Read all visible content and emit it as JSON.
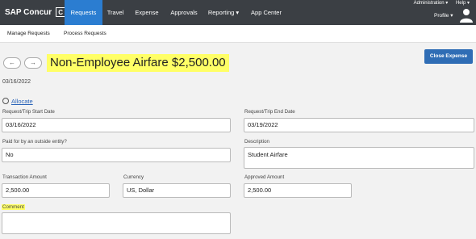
{
  "brand": {
    "name": "SAP Concur",
    "logo_letter": "C"
  },
  "nav": {
    "tabs": [
      {
        "label": "Requests"
      },
      {
        "label": "Travel"
      },
      {
        "label": "Expense"
      },
      {
        "label": "Approvals"
      },
      {
        "label": "Reporting ▾"
      },
      {
        "label": "App Center"
      }
    ],
    "administration": "Administration ▾",
    "help": "Help ▾",
    "profile": "Profile ▾"
  },
  "subnav": {
    "manage": "Manage Requests",
    "process": "Process Requests"
  },
  "header": {
    "back_icon": "←",
    "forward_icon": "→",
    "title": "Non-Employee Airfare $2,500.00",
    "date": "03/16/2022",
    "close_button": "Close Expense"
  },
  "allocate": {
    "label": "Allocate"
  },
  "form": {
    "start_date": {
      "label": "Request/Trip Start Date",
      "value": "03/16/2022"
    },
    "end_date": {
      "label": "Request/Trip End Date",
      "value": "03/19/2022"
    },
    "paid_outside": {
      "label": "Paid for by an outside entity?",
      "value": "No"
    },
    "description": {
      "label": "Description",
      "value": "Student Airfare"
    },
    "transaction_amount": {
      "label": "Transaction Amount",
      "value": "2,500.00"
    },
    "currency": {
      "label": "Currency",
      "value": "US, Dollar"
    },
    "approved_amount": {
      "label": "Approved Amount",
      "value": "2,500.00"
    },
    "comment": {
      "label": "Comment",
      "value": ""
    }
  },
  "colors": {
    "nav_bg": "#3b3f44",
    "active_tab": "#2b7dd1",
    "button_blue": "#2f6db5",
    "highlight": "#ffff66",
    "link": "#2a64b8"
  }
}
